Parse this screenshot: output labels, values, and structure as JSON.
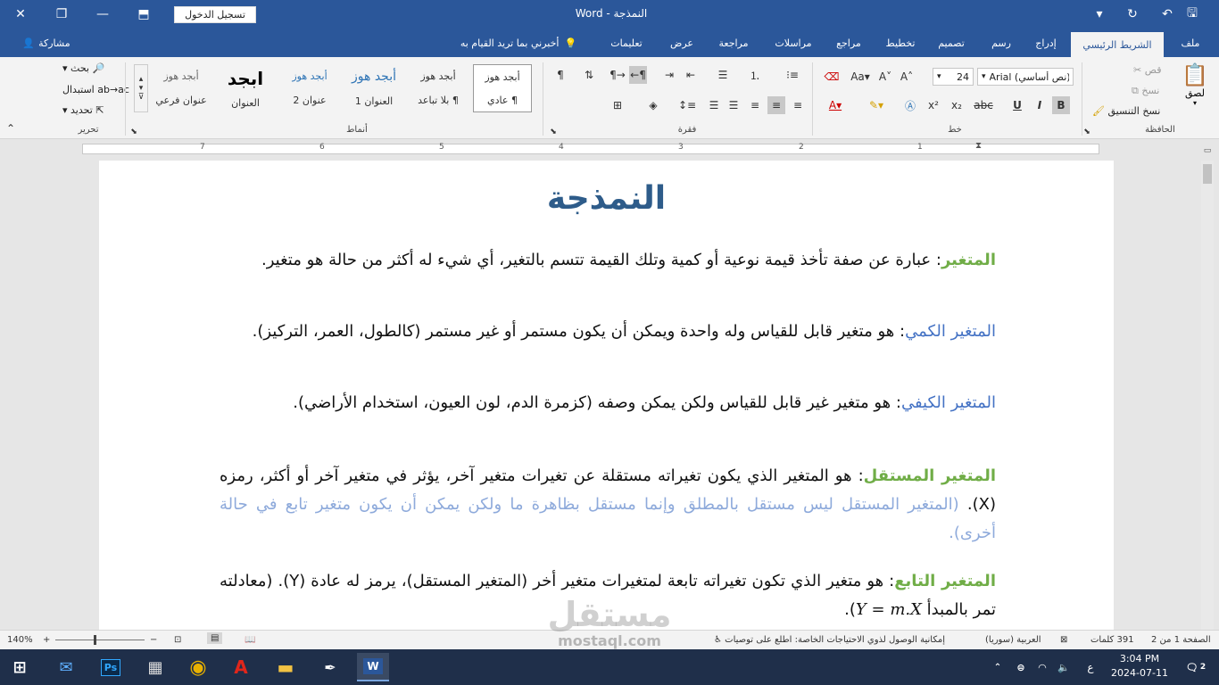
{
  "window": {
    "title": "النمذجة  -  Word",
    "sign_in": "تسجيل الدخول"
  },
  "tabs": [
    {
      "label": "ملف"
    },
    {
      "label": "الشريط الرئيسي"
    },
    {
      "label": "إدراج"
    },
    {
      "label": "رسم"
    },
    {
      "label": "تصميم"
    },
    {
      "label": "تخطيط"
    },
    {
      "label": "مراجع"
    },
    {
      "label": "مراسلات"
    },
    {
      "label": "مراجعة"
    },
    {
      "label": "عرض"
    },
    {
      "label": "تعليمات"
    },
    {
      "label": "أخبرني بما تريد القيام به"
    },
    {
      "label": "مشاركة"
    }
  ],
  "ribbon": {
    "clipboard": {
      "label": "الحافظة",
      "paste": "لصق",
      "cut": "قص",
      "copy": "نسخ",
      "format_painter": "نسخ التنسيق"
    },
    "font": {
      "label": "خط",
      "font_name": "Arial (نص أساسي)",
      "font_size": "24"
    },
    "paragraph": {
      "label": "فقرة"
    },
    "styles": {
      "label": "أنماط",
      "items": [
        {
          "preview": "أبجد هوز",
          "name": "¶ عادي"
        },
        {
          "preview": "أبجد هوز",
          "name": "¶ بلا تباعد"
        },
        {
          "preview": "أبجد هوز",
          "name": "العنوان 1"
        },
        {
          "preview": "أبجد هوز",
          "name": "عنوان 2"
        },
        {
          "preview": "ابجد",
          "name": "العنوان"
        },
        {
          "preview": "أبجد هوز",
          "name": "عنوان فرعي"
        }
      ]
    },
    "editing": {
      "label": "تحرير",
      "find": "بحث",
      "replace": "استبدال",
      "select": "تحديد"
    }
  },
  "ruler": {
    "numbers": [
      "1",
      "2",
      "3",
      "4",
      "5",
      "6",
      "7"
    ]
  },
  "document": {
    "title": "النمذجة",
    "paragraphs": [
      {
        "term": "المتغير",
        "sep": ": ",
        "text": "عبارة عن صفة تأخذ قيمة نوعية أو كمية وتلك القيمة تتسم بالتغير، أي شيء له أكثر من حالة هو متغير."
      },
      {
        "term": "المتغير الكمي",
        "sep": ": ",
        "text": "هو متغير قابل للقياس وله واحدة ويمكن أن يكون مستمر أو غير مستمر (كالطول، العمر، التركيز)."
      },
      {
        "term": "المتغير الكيفي",
        "sep": ": ",
        "text": "هو متغير غير قابل للقياس ولكن يمكن وصفه (كزمرة الدم، لون العيون، استخدام الأراضي)."
      },
      {
        "term": "المتغير المستقل",
        "sep": ": ",
        "text": "هو المتغير الذي يكون تغيراته مستقلة عن تغيرات متغير آخر، يؤثر في متغير آخر أو أكثر، رمزه (X).",
        "note": "(المتغير المستقل ليس مستقل بالمطلق وإنما مستقل بظاهرة ما ولكن يمكن أن يكون متغير تابع في حالة أخرى)."
      },
      {
        "term": "المتغير التابع",
        "sep": ": ",
        "text": "هو متغير الذي تكون تغيراته تابعة لمتغيرات متغير أخر (المتغير المستقل)، يرمز له عادة (Y). (معادلته تمر بالمبدأ",
        "formula": "Y = m.X",
        "tail": ")."
      }
    ]
  },
  "status": {
    "page": "الصفحة 1 من 2",
    "words": "391 كلمات",
    "language": "العربية (سوريا)",
    "accessibility": "إمكانية الوصول لذوي الاحتياجات الخاصة: اطلع على توصيات",
    "zoom": "140%"
  },
  "taskbar": {
    "time": "3:04 PM",
    "date": "2024-07-11",
    "notifications": "2",
    "lang": "ع"
  },
  "watermark": {
    "ar": "مستقل",
    "en": "mostaql.com"
  },
  "colors": {
    "brand": "#2b579a",
    "term_green": "#70ad47",
    "term_blue": "#4472c4",
    "note": "#8eaadb",
    "title": "#2e5c8a"
  }
}
